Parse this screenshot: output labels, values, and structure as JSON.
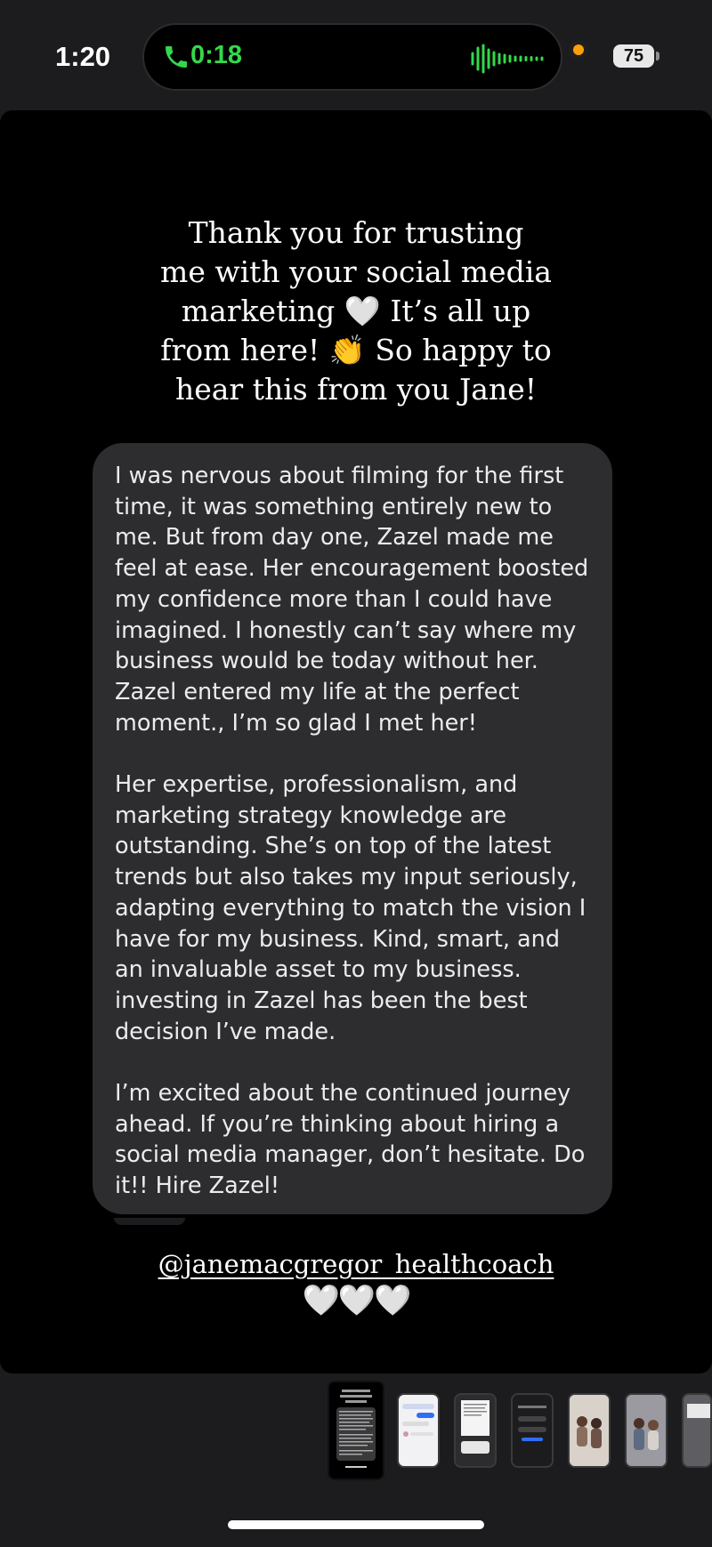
{
  "status_bar": {
    "time": "1:20",
    "call_timer": "0:18",
    "battery": "75",
    "call_color": "#33d94a",
    "mic_indicator_color": "#ff9f0a",
    "icons": [
      "phone-icon",
      "waveform-icon",
      "battery-icon"
    ]
  },
  "story": {
    "caption_lines": [
      "Thank you for trusting",
      "me with your social media",
      "marketing 🤍 It’s all up",
      "from here! 👏 So happy to",
      "hear this from you Jane!"
    ],
    "message_paragraphs": [
      "I was nervous about filming for the first time, it was something entirely new to me. But from day one, Zazel made me feel at ease. Her encouragement boosted my confidence more than I could have imagined. I honestly can’t say where my business would be today without her. Zazel entered my life at the perfect moment., I’m so glad I met her!",
      "Her expertise, professionalism, and marketing strategy knowledge are outstanding. She’s on top of the latest trends but also takes my input seriously, adapting everything to match the vision I have for my business. Kind, smart, and an invaluable asset to my business. investing in Zazel has been the best decision I’ve made.",
      "I’m excited about the continued journey ahead. If you’re thinking about hiring a social media manager, don’t hesitate. Do it!! Hire Zazel!"
    ],
    "mention": "@janemacgregor_healthcoach",
    "hearts": "🤍🤍🤍"
  },
  "thumbnails": [
    {
      "name": "thumb-1",
      "active": true
    },
    {
      "name": "thumb-2",
      "active": false
    },
    {
      "name": "thumb-3",
      "active": false
    },
    {
      "name": "thumb-4",
      "active": false
    },
    {
      "name": "thumb-5",
      "active": false
    },
    {
      "name": "thumb-6",
      "active": false
    },
    {
      "name": "thumb-7",
      "active": false
    }
  ]
}
